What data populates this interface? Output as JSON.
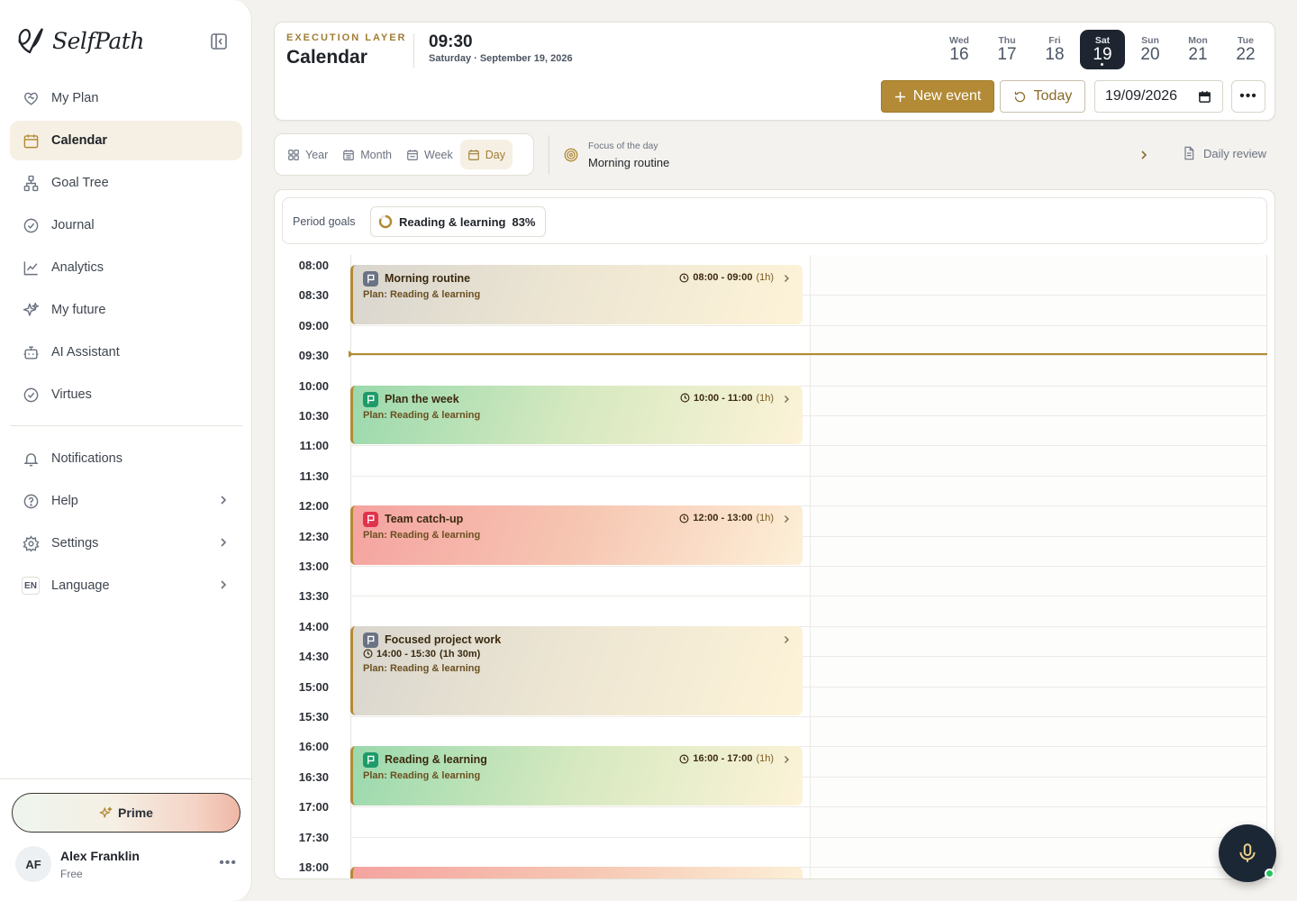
{
  "sidebar": {
    "logo_text": "SelfPath",
    "items": [
      {
        "label": "My Plan",
        "icon": "heart-handshake-icon"
      },
      {
        "label": "Calendar",
        "icon": "calendar-icon",
        "active": true
      },
      {
        "label": "Goal Tree",
        "icon": "hierarchy-icon"
      },
      {
        "label": "Journal",
        "icon": "check-circle-icon"
      },
      {
        "label": "Analytics",
        "icon": "line-chart-icon"
      },
      {
        "label": "My future",
        "icon": "sparkles-icon"
      },
      {
        "label": "AI Assistant",
        "icon": "bot-icon"
      },
      {
        "label": "Virtues",
        "icon": "badge-check-icon"
      }
    ],
    "secondary": [
      {
        "label": "Notifications",
        "icon": "bell-icon"
      },
      {
        "label": "Help",
        "icon": "help-circle-icon"
      },
      {
        "label": "Settings",
        "icon": "gear-icon"
      },
      {
        "label": "Language",
        "badge": "EN"
      }
    ],
    "prime_label": "Prime",
    "user": {
      "initials": "AF",
      "name": "Alex Franklin",
      "plan": "Free"
    }
  },
  "header": {
    "eyebrow": "EXECUTION LAYER",
    "title": "Calendar",
    "time": "09:30",
    "date": "Saturday · September 19, 2026",
    "days": [
      {
        "name": "Wed",
        "num": "16"
      },
      {
        "name": "Thu",
        "num": "17"
      },
      {
        "name": "Fri",
        "num": "18"
      },
      {
        "name": "Sat",
        "num": "19",
        "selected": true
      },
      {
        "name": "Sun",
        "num": "20"
      },
      {
        "name": "Mon",
        "num": "21"
      },
      {
        "name": "Tue",
        "num": "22"
      }
    ],
    "new_event_label": "New event",
    "today_label": "Today",
    "date_value": "19/09/2026"
  },
  "views": [
    {
      "label": "Year"
    },
    {
      "label": "Month"
    },
    {
      "label": "Week"
    },
    {
      "label": "Day",
      "active": true
    }
  ],
  "focus": {
    "label": "Focus of the day",
    "value": "Morning routine"
  },
  "daily_review_label": "Daily review",
  "period_goals": {
    "label": "Period goals",
    "goal": "Reading & learning",
    "percent": "83%",
    "progress": 0.83
  },
  "time_labels": [
    "08:00",
    "08:30",
    "09:00",
    "09:30",
    "10:00",
    "10:30",
    "11:00",
    "11:30",
    "12:00",
    "12:30",
    "13:00",
    "13:30",
    "14:00",
    "14:30",
    "15:00",
    "15:30",
    "16:00",
    "16:30",
    "17:00",
    "17:30",
    "18:00"
  ],
  "events": [
    {
      "title": "Morning routine",
      "time": "08:00 - 09:00",
      "duration": "(1h)",
      "plan": "Plan: Reading & learning",
      "color": "gray"
    },
    {
      "title": "Plan the week",
      "time": "10:00 - 11:00",
      "duration": "(1h)",
      "plan": "Plan: Reading & learning",
      "color": "green"
    },
    {
      "title": "Team catch-up",
      "time": "12:00 - 13:00",
      "duration": "(1h)",
      "plan": "Plan: Reading & learning",
      "color": "red"
    },
    {
      "title": "Focused project work",
      "time": "14:00 - 15:30",
      "duration": "(1h 30m)",
      "plan": "Plan: Reading & learning",
      "color": "gray"
    },
    {
      "title": "Reading & learning",
      "time": "16:00 - 17:00",
      "duration": "(1h)",
      "plan": "Plan: Reading & learning",
      "color": "green"
    }
  ],
  "colors": {
    "accent": "#b38a35",
    "dark": "#1e2530"
  }
}
